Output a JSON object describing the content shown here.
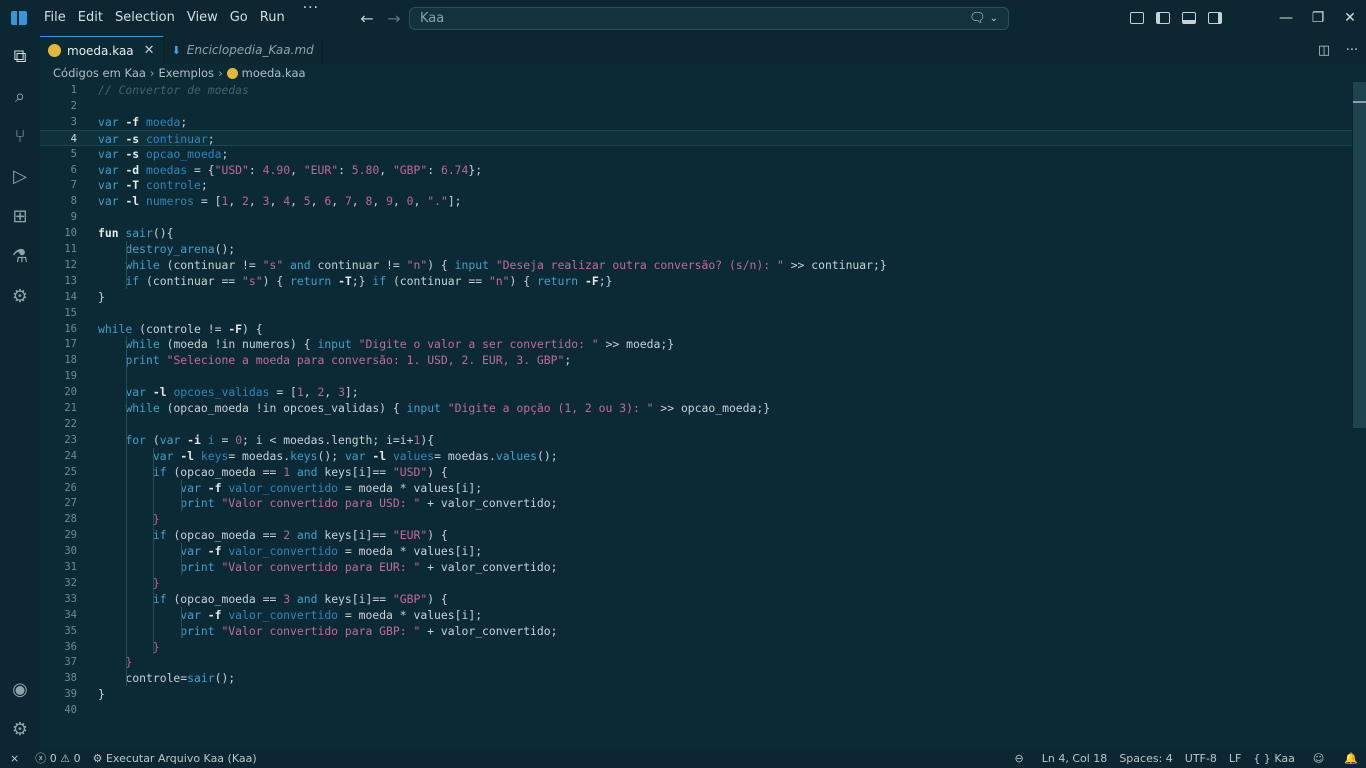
{
  "menu": [
    "File",
    "Edit",
    "Selection",
    "View",
    "Go",
    "Run"
  ],
  "menu_overflow": "···",
  "search": {
    "text": "Kaa"
  },
  "tabs": [
    {
      "label": "moeda.kaa",
      "active": true
    },
    {
      "label": "Enciclopedia_Kaa.md",
      "active": false
    }
  ],
  "breadcrumb": [
    "Códigos em Kaa",
    "Exemplos",
    "moeda.kaa"
  ],
  "editor": {
    "current_line": 4,
    "lines": [
      [
        [
          "cm",
          "// Convertor de moedas"
        ]
      ],
      [],
      [
        [
          "kw",
          "var "
        ],
        [
          "fl",
          "-f "
        ],
        [
          "id",
          "moeda"
        ],
        [
          "pl",
          ";"
        ]
      ],
      [
        [
          "kw",
          "var "
        ],
        [
          "fl",
          "-s "
        ],
        [
          "id",
          "continuar"
        ],
        [
          "pl",
          ";"
        ]
      ],
      [
        [
          "kw",
          "var "
        ],
        [
          "fl",
          "-s "
        ],
        [
          "id",
          "opcao_moeda"
        ],
        [
          "pl",
          ";"
        ]
      ],
      [
        [
          "kw",
          "var "
        ],
        [
          "fl",
          "-d "
        ],
        [
          "id",
          "moedas"
        ],
        [
          "pl",
          " = {"
        ],
        [
          "str",
          "\"USD\""
        ],
        [
          "pl",
          ": "
        ],
        [
          "num",
          "4.90"
        ],
        [
          "pl",
          ", "
        ],
        [
          "str",
          "\"EUR\""
        ],
        [
          "pl",
          ": "
        ],
        [
          "num",
          "5.80"
        ],
        [
          "pl",
          ", "
        ],
        [
          "str",
          "\"GBP\""
        ],
        [
          "pl",
          ": "
        ],
        [
          "num",
          "6.74"
        ],
        [
          "pl",
          "};"
        ]
      ],
      [
        [
          "kw",
          "var "
        ],
        [
          "fl",
          "-T "
        ],
        [
          "id",
          "controle"
        ],
        [
          "pl",
          ";"
        ]
      ],
      [
        [
          "kw",
          "var "
        ],
        [
          "fl",
          "-l "
        ],
        [
          "id",
          "numeros"
        ],
        [
          "pl",
          " = ["
        ],
        [
          "num",
          "1"
        ],
        [
          "pl",
          ", "
        ],
        [
          "num",
          "2"
        ],
        [
          "pl",
          ", "
        ],
        [
          "num",
          "3"
        ],
        [
          "pl",
          ", "
        ],
        [
          "num",
          "4"
        ],
        [
          "pl",
          ", "
        ],
        [
          "num",
          "5"
        ],
        [
          "pl",
          ", "
        ],
        [
          "num",
          "6"
        ],
        [
          "pl",
          ", "
        ],
        [
          "num",
          "7"
        ],
        [
          "pl",
          ", "
        ],
        [
          "num",
          "8"
        ],
        [
          "pl",
          ", "
        ],
        [
          "num",
          "9"
        ],
        [
          "pl",
          ", "
        ],
        [
          "num",
          "0"
        ],
        [
          "pl",
          ", "
        ],
        [
          "str",
          "\".\""
        ],
        [
          "pl",
          "];"
        ]
      ],
      [],
      [
        [
          "fl",
          "fun "
        ],
        [
          "fn",
          "sair"
        ],
        [
          "pl",
          "(){"
        ]
      ],
      [
        [
          "pl",
          "    "
        ],
        [
          "fn",
          "destroy_arena"
        ],
        [
          "pl",
          "();"
        ]
      ],
      [
        [
          "pl",
          "    "
        ],
        [
          "kw",
          "while "
        ],
        [
          "pl",
          "(continuar != "
        ],
        [
          "str",
          "\"s\""
        ],
        [
          "kw",
          " and "
        ],
        [
          "pl",
          "continuar != "
        ],
        [
          "str",
          "\"n\""
        ],
        [
          "pl",
          ") { "
        ],
        [
          "kw",
          "input "
        ],
        [
          "str",
          "\"Deseja realizar outra conversão? (s/n): \""
        ],
        [
          "pl",
          " >> continuar;}"
        ]
      ],
      [
        [
          "pl",
          "    "
        ],
        [
          "kw",
          "if "
        ],
        [
          "pl",
          "(continuar == "
        ],
        [
          "str",
          "\"s\""
        ],
        [
          "pl",
          ") { "
        ],
        [
          "kw",
          "return "
        ],
        [
          "fl",
          "-T"
        ],
        [
          "pl",
          ";} "
        ],
        [
          "kw",
          "if "
        ],
        [
          "pl",
          "(continuar == "
        ],
        [
          "str",
          "\"n\""
        ],
        [
          "pl",
          ") { "
        ],
        [
          "kw",
          "return "
        ],
        [
          "fl",
          "-F"
        ],
        [
          "pl",
          ";}"
        ]
      ],
      [
        [
          "pl",
          "}"
        ]
      ],
      [],
      [
        [
          "kw",
          "while "
        ],
        [
          "pl",
          "(controle != "
        ],
        [
          "fl",
          "-F"
        ],
        [
          "pl",
          ") {"
        ]
      ],
      [
        [
          "pl",
          "    "
        ],
        [
          "kw",
          "while "
        ],
        [
          "pl",
          "(moeda !in numeros) { "
        ],
        [
          "kw",
          "input "
        ],
        [
          "str",
          "\"Digite o valor a ser convertido: \""
        ],
        [
          "pl",
          " >> moeda;}"
        ]
      ],
      [
        [
          "pl",
          "    "
        ],
        [
          "kw",
          "print "
        ],
        [
          "str",
          "\"Selecione a moeda para conversão: 1. USD, 2. EUR, 3. GBP\""
        ],
        [
          "pl",
          ";"
        ]
      ],
      [],
      [
        [
          "pl",
          "    "
        ],
        [
          "kw",
          "var "
        ],
        [
          "fl",
          "-l "
        ],
        [
          "id",
          "opcoes_validas"
        ],
        [
          "pl",
          " = ["
        ],
        [
          "num",
          "1"
        ],
        [
          "pl",
          ", "
        ],
        [
          "num",
          "2"
        ],
        [
          "pl",
          ", "
        ],
        [
          "num",
          "3"
        ],
        [
          "pl",
          "];"
        ]
      ],
      [
        [
          "pl",
          "    "
        ],
        [
          "kw",
          "while "
        ],
        [
          "pl",
          "(opcao_moeda !in opcoes_validas) { "
        ],
        [
          "kw",
          "input "
        ],
        [
          "str",
          "\"Digite a opção (1, 2 ou 3): \""
        ],
        [
          "pl",
          " >> opcao_moeda;}"
        ]
      ],
      [],
      [
        [
          "pl",
          "    "
        ],
        [
          "kw",
          "for "
        ],
        [
          "pl",
          "("
        ],
        [
          "kw",
          "var "
        ],
        [
          "fl",
          "-i "
        ],
        [
          "id",
          "i"
        ],
        [
          "pl",
          " = "
        ],
        [
          "num",
          "0"
        ],
        [
          "pl",
          "; i < moedas.length; i=i+"
        ],
        [
          "num",
          "1"
        ],
        [
          "pl",
          "){"
        ]
      ],
      [
        [
          "pl",
          "        "
        ],
        [
          "kw",
          "var "
        ],
        [
          "fl",
          "-l "
        ],
        [
          "id",
          "keys"
        ],
        [
          "pl",
          "= moedas."
        ],
        [
          "fn",
          "keys"
        ],
        [
          "pl",
          "(); "
        ],
        [
          "kw",
          "var "
        ],
        [
          "fl",
          "-l "
        ],
        [
          "id",
          "values"
        ],
        [
          "pl",
          "= moedas."
        ],
        [
          "fn",
          "values"
        ],
        [
          "pl",
          "();"
        ]
      ],
      [
        [
          "pl",
          "        "
        ],
        [
          "kw",
          "if "
        ],
        [
          "pl",
          "(opcao_moeda == "
        ],
        [
          "num",
          "1"
        ],
        [
          "kw",
          " and "
        ],
        [
          "pl",
          "keys[i]== "
        ],
        [
          "str",
          "\"USD\""
        ],
        [
          "pl",
          ") {"
        ]
      ],
      [
        [
          "pl",
          "            "
        ],
        [
          "kw",
          "var "
        ],
        [
          "fl",
          "-f "
        ],
        [
          "id",
          "valor_convertido"
        ],
        [
          "pl",
          " = moeda * values[i];"
        ]
      ],
      [
        [
          "pl",
          "            "
        ],
        [
          "kw",
          "print "
        ],
        [
          "str",
          "\"Valor convertido para USD: \""
        ],
        [
          "pl",
          " + valor_convertido;"
        ]
      ],
      [
        [
          "pl",
          "        "
        ],
        [
          "br",
          "}"
        ]
      ],
      [
        [
          "pl",
          "        "
        ],
        [
          "kw",
          "if "
        ],
        [
          "pl",
          "(opcao_moeda == "
        ],
        [
          "num",
          "2"
        ],
        [
          "kw",
          " and "
        ],
        [
          "pl",
          "keys[i]== "
        ],
        [
          "str",
          "\"EUR\""
        ],
        [
          "pl",
          ") {"
        ]
      ],
      [
        [
          "pl",
          "            "
        ],
        [
          "kw",
          "var "
        ],
        [
          "fl",
          "-f "
        ],
        [
          "id",
          "valor_convertido"
        ],
        [
          "pl",
          " = moeda * values[i];"
        ]
      ],
      [
        [
          "pl",
          "            "
        ],
        [
          "kw",
          "print "
        ],
        [
          "str",
          "\"Valor convertido para EUR: \""
        ],
        [
          "pl",
          " + valor_convertido;"
        ]
      ],
      [
        [
          "pl",
          "        "
        ],
        [
          "br",
          "}"
        ]
      ],
      [
        [
          "pl",
          "        "
        ],
        [
          "kw",
          "if "
        ],
        [
          "pl",
          "(opcao_moeda == "
        ],
        [
          "num",
          "3"
        ],
        [
          "kw",
          " and "
        ],
        [
          "pl",
          "keys[i]== "
        ],
        [
          "str",
          "\"GBP\""
        ],
        [
          "pl",
          ") {"
        ]
      ],
      [
        [
          "pl",
          "            "
        ],
        [
          "kw",
          "var "
        ],
        [
          "fl",
          "-f "
        ],
        [
          "id",
          "valor_convertido"
        ],
        [
          "pl",
          " = moeda * values[i];"
        ]
      ],
      [
        [
          "pl",
          "            "
        ],
        [
          "kw",
          "print "
        ],
        [
          "str",
          "\"Valor convertido para GBP: \""
        ],
        [
          "pl",
          " + valor_convertido;"
        ]
      ],
      [
        [
          "pl",
          "        "
        ],
        [
          "br",
          "}"
        ]
      ],
      [
        [
          "pl",
          "    "
        ],
        [
          "br",
          "}"
        ]
      ],
      [
        [
          "pl",
          "    controle="
        ],
        [
          "fn",
          "sair"
        ],
        [
          "pl",
          "();"
        ]
      ],
      [
        [
          "pl",
          "}"
        ]
      ],
      []
    ]
  },
  "statusbar": {
    "problems_errors": "0",
    "problems_warnings": "0",
    "run_task": "Executar Arquivo Kaa (Kaa)",
    "cursor": "Ln 4, Col 18",
    "indent": "Spaces: 4",
    "encoding": "UTF-8",
    "eol": "LF",
    "language": "Kaa"
  },
  "icons": {
    "explorer": "files-icon",
    "search": "search-icon",
    "scm": "source-control-icon",
    "debug": "run-debug-icon",
    "extensions": "extensions-icon",
    "testing": "flask-icon",
    "remote": "remote-explorer-icon",
    "accounts": "account-icon",
    "settings": "gear-icon"
  },
  "colors": {
    "background": "#0b2a35",
    "chrome": "#0c2731",
    "accent": "#3a95d6"
  }
}
